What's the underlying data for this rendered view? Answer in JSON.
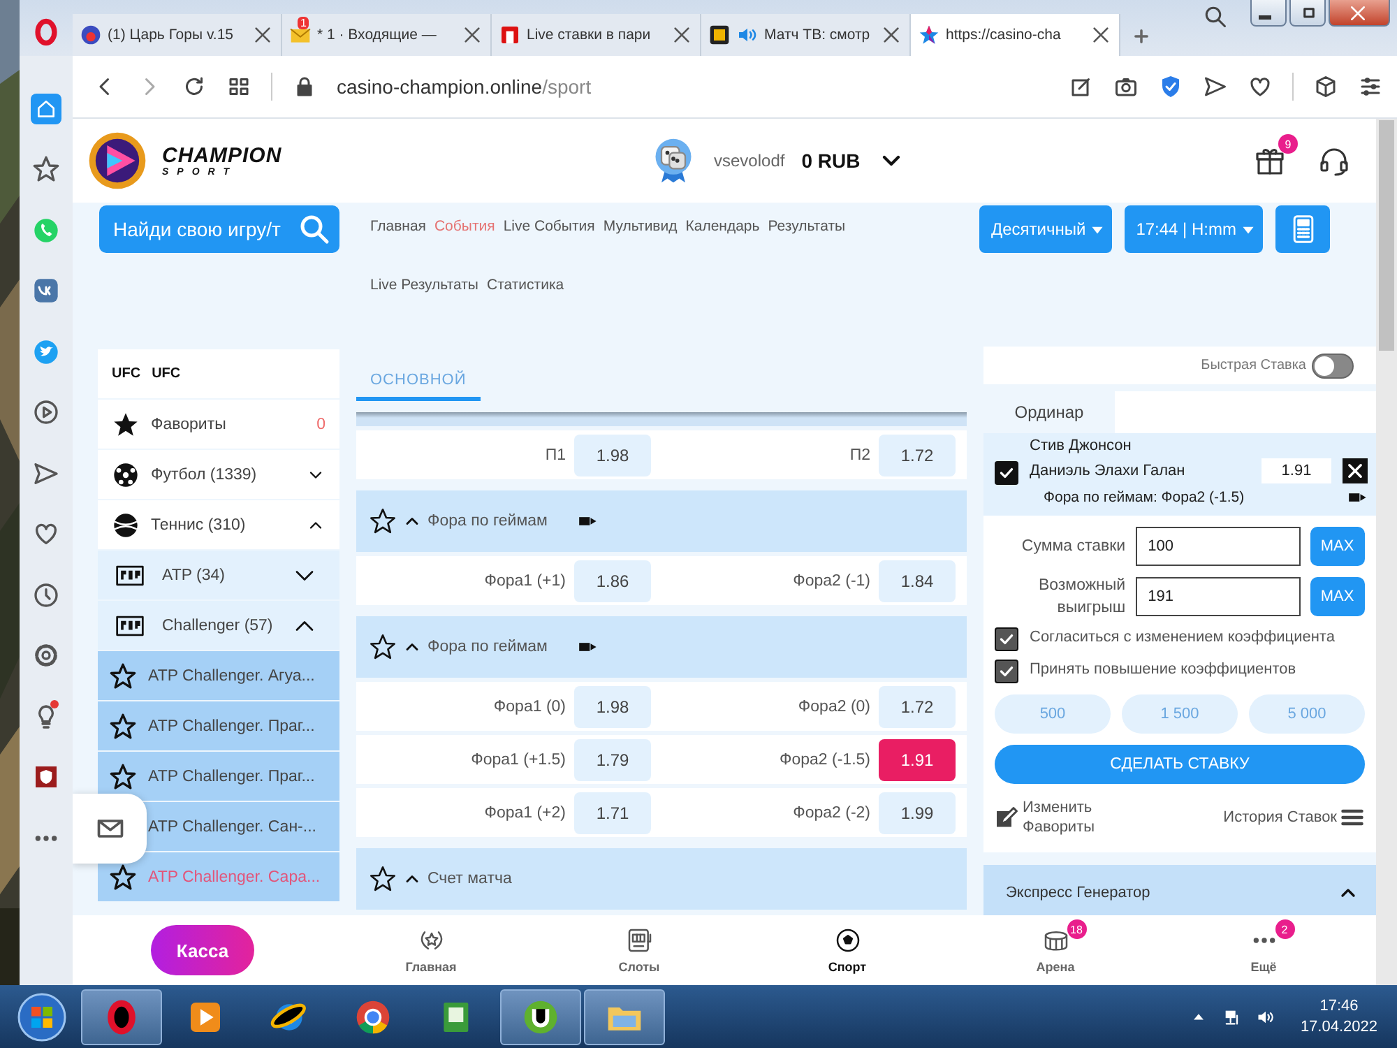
{
  "browser": {
    "tabs": [
      {
        "kind": "game",
        "title": "(1) Царь Горы v.15",
        "audio": false,
        "selected": false
      },
      {
        "kind": "mail",
        "badge": "1",
        "title": "* 1 · Входящие —",
        "audio": false,
        "selected": false
      },
      {
        "kind": "red-logo",
        "title": "Live ставки в пари",
        "audio": false,
        "selected": false
      },
      {
        "kind": "dark-logo",
        "title": "Матч ТВ: смотр",
        "audio": true,
        "selected": false
      },
      {
        "kind": "star",
        "title": "https://casino-cha",
        "audio": false,
        "selected": true
      }
    ],
    "address": {
      "host": "casino-champion.online",
      "path": "/sport"
    }
  },
  "opera_sidebar": [
    {
      "kind": "home",
      "selected": true
    },
    {
      "kind": "star",
      "selected": false
    },
    {
      "kind": "whatsapp",
      "selected": false
    },
    {
      "kind": "vk",
      "selected": false
    },
    {
      "kind": "twitter",
      "selected": false
    },
    {
      "kind": "player",
      "selected": false
    },
    {
      "kind": "send",
      "selected": false
    },
    {
      "kind": "heart",
      "selected": false
    },
    {
      "kind": "clock",
      "selected": false
    },
    {
      "kind": "gear",
      "selected": false
    },
    {
      "kind": "bulb",
      "selected": false,
      "alert": true
    },
    {
      "kind": "shield",
      "selected": false
    },
    {
      "kind": "more",
      "selected": false
    }
  ],
  "header": {
    "brand": "CHAMPION",
    "brand_sub": "SPORT",
    "username": "vsevolodf",
    "balance": "0 RUB",
    "gift_badge": "9"
  },
  "toolbar": {
    "search": "Найди свою игру/т",
    "nav_rows": [
      [
        {
          "label": "Главная",
          "selected": false
        },
        {
          "label": "События",
          "selected": true
        },
        {
          "label": "Live События",
          "selected": false
        },
        {
          "label": "Мультивид",
          "selected": false
        },
        {
          "label": "Календарь",
          "selected": false
        },
        {
          "label": "Результаты",
          "selected": false
        }
      ],
      [
        {
          "label": "Live Результаты",
          "selected": false
        },
        {
          "label": "Статистика",
          "selected": false
        }
      ]
    ],
    "odds_format": "Десятичный",
    "time_format": "17:44 | H:mm"
  },
  "sports": [
    {
      "kind": "ufc",
      "icon_text": "UFC",
      "label": "UFC"
    },
    {
      "kind": "favorites",
      "label": "Фавориты",
      "count": "0"
    },
    {
      "kind": "football",
      "label": "Футбол (1339)",
      "expanded": false
    },
    {
      "kind": "tennis",
      "label": "Теннис (310)",
      "expanded": true,
      "children": [
        {
          "kind": "region",
          "label": "ATP (34)",
          "expanded": false
        },
        {
          "kind": "region",
          "label": "Challenger (57)",
          "expanded": true,
          "children": [
            {
              "kind": "tournament",
              "label": "ATP Challenger. Агуа...",
              "selected": false
            },
            {
              "kind": "tournament",
              "label": "ATP Challenger. Праг...",
              "selected": false
            },
            {
              "kind": "tournament",
              "label": "ATP Challenger. Праг...",
              "selected": false
            },
            {
              "kind": "tournament-text",
              "label": "ATP Challenger. Сан-...",
              "selected": false
            },
            {
              "kind": "tournament",
              "label": "ATP Challenger. Сара...",
              "selected": true
            }
          ]
        }
      ]
    }
  ],
  "market_tabs": [
    {
      "label": "ОСНОВНОЙ",
      "selected": true
    }
  ],
  "markets": [
    {
      "rows": [
        {
          "cells": [
            {
              "label": "П1",
              "odd": "1.98",
              "selected": false
            },
            {
              "label": "П2",
              "odd": "1.72",
              "selected": false
            }
          ]
        }
      ]
    },
    {
      "title": "Фора по геймам",
      "expanded": true,
      "rows": [
        {
          "cells": [
            {
              "label": "Фора1 (+1)",
              "odd": "1.86",
              "selected": false
            },
            {
              "label": "Фора2 (-1)",
              "odd": "1.84",
              "selected": false
            }
          ]
        }
      ]
    },
    {
      "title": "Фора по геймам",
      "expanded": true,
      "rows": [
        {
          "cells": [
            {
              "label": "Фора1 (0)",
              "odd": "1.98",
              "selected": false
            },
            {
              "label": "Фора2 (0)",
              "odd": "1.72",
              "selected": false
            }
          ]
        },
        {
          "cells": [
            {
              "label": "Фора1 (+1.5)",
              "odd": "1.79",
              "selected": false
            },
            {
              "label": "Фора2 (-1.5)",
              "odd": "1.91",
              "selected": true
            }
          ]
        },
        {
          "cells": [
            {
              "label": "Фора1 (+2)",
              "odd": "1.71",
              "selected": false
            },
            {
              "label": "Фора2 (-2)",
              "odd": "1.99",
              "selected": false
            }
          ]
        }
      ]
    },
    {
      "title": "Счет матча",
      "expanded": true
    }
  ],
  "bet_slip": {
    "quick_bet": {
      "label": "Быстрая Ставка",
      "on": false
    },
    "tabs": [
      {
        "label": "Ординар",
        "selected": true
      }
    ],
    "selection": {
      "checked": true,
      "team1": "Стив Джонсон",
      "team2": "Даниэль Элахи Галан",
      "odd": "1.91",
      "market": "Фора по геймам: Фора2 (-1.5)"
    },
    "fields": [
      {
        "label": "Сумма ставки",
        "value": "100",
        "button": "MAX"
      },
      {
        "label": "Возможный выигрыш",
        "value": "191",
        "button": "MAX"
      }
    ],
    "options": [
      {
        "label": "Согласиться с изменением коэффициента",
        "checked": true
      },
      {
        "label": "Принять повышение коэффициентов",
        "checked": true
      }
    ],
    "amounts": [
      "500",
      "1 500",
      "5 000"
    ],
    "submit": "СДЕЛАТЬ СТАВКУ",
    "edit_favorites": "Изменить Фавориты",
    "history": "История Ставок",
    "express": {
      "title": "Экспресс Генератор",
      "expanded": true
    }
  },
  "bottom_nav": {
    "cashier": "Касса",
    "items": [
      {
        "kind": "wreath",
        "label": "Главная",
        "selected": false
      },
      {
        "kind": "slots",
        "label": "Слоты",
        "selected": false
      },
      {
        "kind": "ball",
        "label": "Спорт",
        "selected": true
      },
      {
        "kind": "arena",
        "label": "Арена",
        "badge": "18",
        "selected": false
      },
      {
        "kind": "more",
        "label": "Ещё",
        "badge": "2",
        "selected": false
      }
    ]
  },
  "taskbar": {
    "apps": [
      {
        "kind": "opera",
        "selected": true
      },
      {
        "kind": "media",
        "selected": false
      },
      {
        "kind": "ie",
        "selected": false
      },
      {
        "kind": "chrome",
        "selected": false
      },
      {
        "kind": "book",
        "selected": false
      },
      {
        "kind": "torrent",
        "selected": true
      },
      {
        "kind": "folder",
        "selected": true
      }
    ],
    "time": "17:46",
    "date": "17.04.2022"
  }
}
